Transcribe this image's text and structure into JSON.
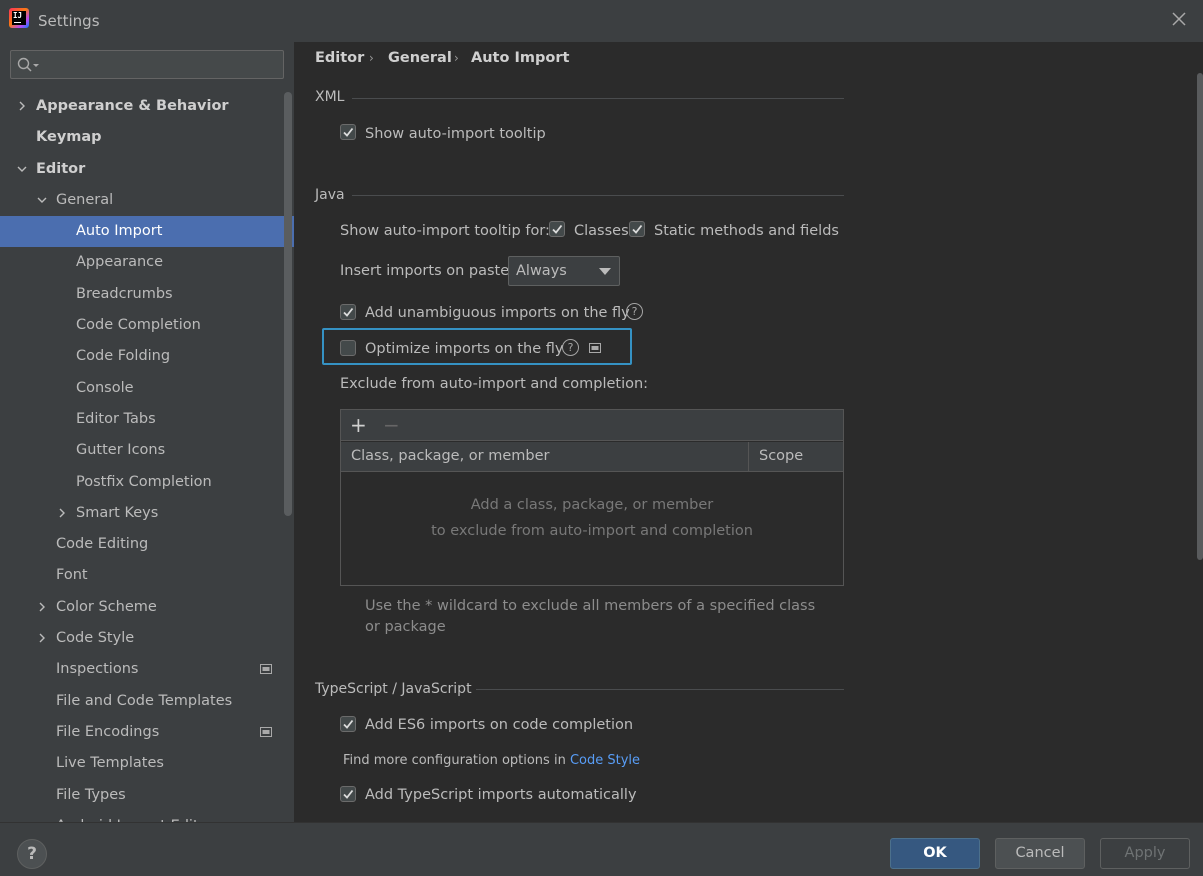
{
  "window": {
    "title": "Settings"
  },
  "search": {
    "placeholder": "",
    "value": ""
  },
  "sidebar": {
    "items": [
      {
        "label": "Appearance & Behavior",
        "indent": 0,
        "chevron": "right",
        "bold": true
      },
      {
        "label": "Keymap",
        "indent": 0,
        "chevron": "none",
        "bold": true
      },
      {
        "label": "Editor",
        "indent": 0,
        "chevron": "down",
        "bold": true
      },
      {
        "label": "General",
        "indent": 1,
        "chevron": "down"
      },
      {
        "label": "Auto Import",
        "indent": 2,
        "chevron": "none",
        "selected": true
      },
      {
        "label": "Appearance",
        "indent": 2,
        "chevron": "none"
      },
      {
        "label": "Breadcrumbs",
        "indent": 2,
        "chevron": "none"
      },
      {
        "label": "Code Completion",
        "indent": 2,
        "chevron": "none"
      },
      {
        "label": "Code Folding",
        "indent": 2,
        "chevron": "none"
      },
      {
        "label": "Console",
        "indent": 2,
        "chevron": "none"
      },
      {
        "label": "Editor Tabs",
        "indent": 2,
        "chevron": "none"
      },
      {
        "label": "Gutter Icons",
        "indent": 2,
        "chevron": "none"
      },
      {
        "label": "Postfix Completion",
        "indent": 2,
        "chevron": "none"
      },
      {
        "label": "Smart Keys",
        "indent": 2,
        "chevron": "right"
      },
      {
        "label": "Code Editing",
        "indent": 1,
        "chevron": "none"
      },
      {
        "label": "Font",
        "indent": 1,
        "chevron": "none"
      },
      {
        "label": "Color Scheme",
        "indent": 1,
        "chevron": "right"
      },
      {
        "label": "Code Style",
        "indent": 1,
        "chevron": "right"
      },
      {
        "label": "Inspections",
        "indent": 1,
        "chevron": "none",
        "project_icon": true
      },
      {
        "label": "File and Code Templates",
        "indent": 1,
        "chevron": "none"
      },
      {
        "label": "File Encodings",
        "indent": 1,
        "chevron": "none",
        "project_icon": true
      },
      {
        "label": "Live Templates",
        "indent": 1,
        "chevron": "none"
      },
      {
        "label": "File Types",
        "indent": 1,
        "chevron": "none"
      },
      {
        "label": "Android Layout Editor",
        "indent": 1,
        "chevron": "none"
      }
    ]
  },
  "breadcrumb": [
    "Editor",
    "General",
    "Auto Import"
  ],
  "xml": {
    "title": "XML",
    "show_tooltip": {
      "label": "Show auto-import tooltip",
      "checked": true
    }
  },
  "java": {
    "title": "Java",
    "tooltip_for_label": "Show auto-import tooltip for:",
    "classes": {
      "label": "Classes",
      "checked": true
    },
    "static": {
      "label": "Static methods and fields",
      "checked": true
    },
    "insert_on_paste_label": "Insert imports on paste:",
    "insert_on_paste_value": "Always",
    "add_unambiguous": {
      "label": "Add unambiguous imports on the fly",
      "checked": true
    },
    "optimize": {
      "label": "Optimize imports on the fly",
      "checked": false
    },
    "exclude_label": "Exclude from auto-import and completion:",
    "table": {
      "add": "+",
      "remove": "−",
      "columns": [
        "Class, package, or member",
        "Scope"
      ],
      "empty_line1": "Add a class, package, or member",
      "empty_line2": "to exclude from auto-import and completion"
    },
    "hint": "Use the * wildcard to exclude all members of a specified class or package"
  },
  "ts": {
    "title": "TypeScript / JavaScript",
    "add_es6": {
      "label": "Add ES6 imports on code completion",
      "checked": true
    },
    "more_config_prefix": "Find more configuration options in",
    "more_config_link": "Code Style",
    "add_ts": {
      "label": "Add TypeScript imports automatically",
      "checked": true
    }
  },
  "footer": {
    "help": "?",
    "ok": "OK",
    "cancel": "Cancel",
    "apply": "Apply"
  },
  "colors": {
    "selection": "#4b6eaf",
    "focus": "#3592c4",
    "link": "#589df6",
    "ok_button": "#365880"
  }
}
